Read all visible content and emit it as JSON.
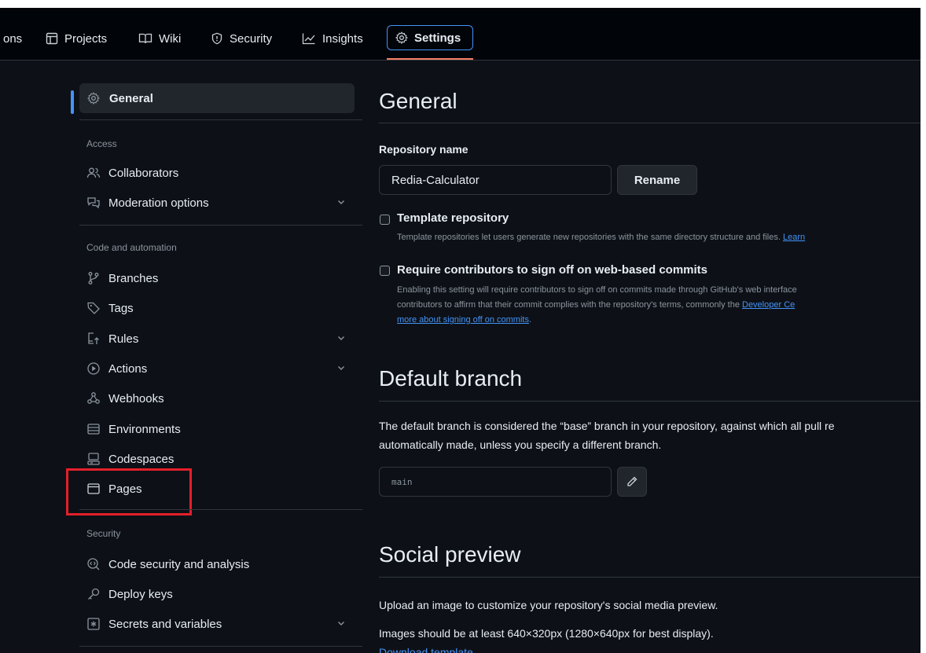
{
  "nav": {
    "tabs": [
      {
        "label": "ons",
        "icon": "none"
      },
      {
        "label": "Projects",
        "icon": "table-icon"
      },
      {
        "label": "Wiki",
        "icon": "book-icon"
      },
      {
        "label": "Security",
        "icon": "shield-icon"
      },
      {
        "label": "Insights",
        "icon": "graph-icon"
      },
      {
        "label": "Settings",
        "icon": "gear-icon",
        "active": true
      }
    ]
  },
  "sidebar": {
    "general": "General",
    "access_heading": "Access",
    "collaborators": "Collaborators",
    "moderation": "Moderation options",
    "code_heading": "Code and automation",
    "branches": "Branches",
    "tags": "Tags",
    "rules": "Rules",
    "actions": "Actions",
    "webhooks": "Webhooks",
    "environments": "Environments",
    "codespaces": "Codespaces",
    "pages": "Pages",
    "security_heading": "Security",
    "code_security": "Code security and analysis",
    "deploy_keys": "Deploy keys",
    "secrets": "Secrets and variables"
  },
  "main": {
    "general_title": "General",
    "repo_name_label": "Repository name",
    "repo_name_value": "Redia-Calculator",
    "rename_button": "Rename",
    "template_title": "Template repository",
    "template_desc": "Template repositories let users generate new repositories with the same directory structure and files.",
    "template_link": "Learn",
    "signoff_title": "Require contributors to sign off on web-based commits",
    "signoff_desc_1": "Enabling this setting will require contributors to sign off on commits made through GitHub's web interface",
    "signoff_desc_2": "contributors to affirm that their commit complies with the repository's terms, commonly the",
    "signoff_link_1": "Developer Ce",
    "signoff_link_2": "more about signing off on commits",
    "default_branch_title": "Default branch",
    "default_branch_desc_1": "The default branch is considered the “base” branch in your repository, against which all pull re",
    "default_branch_desc_2": "automatically made, unless you specify a different branch.",
    "branch_value": "main",
    "social_title": "Social preview",
    "social_desc_1": "Upload an image to customize your repository's social media preview.",
    "social_desc_2": "Images should be at least 640×320px (1280×640px for best display).",
    "download_template": "Download template"
  },
  "colors": {
    "background": "#0d1117",
    "accent": "#4493f8",
    "highlight_box": "#e3202a",
    "active_underline": "#f78166"
  }
}
